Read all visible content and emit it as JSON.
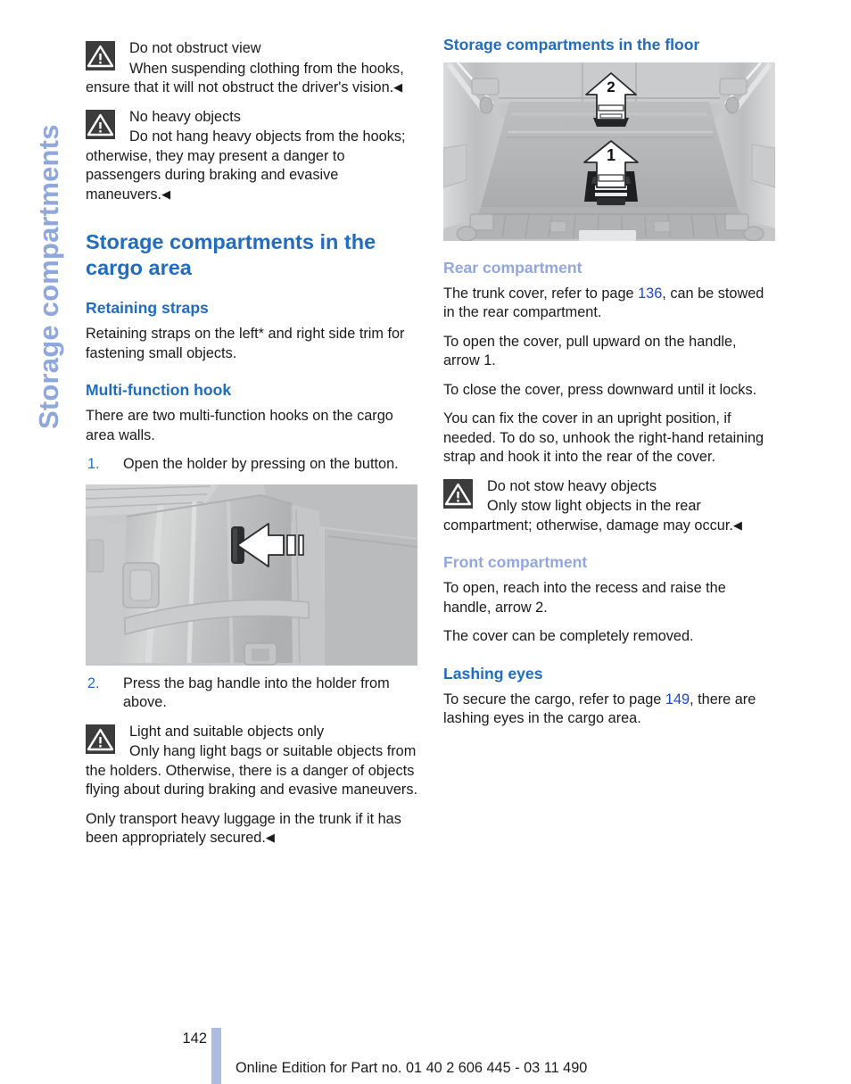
{
  "sidebar": {
    "tab_label": "Storage compartments"
  },
  "left_column": {
    "warning_1": {
      "icon": "warning-triangle-icon",
      "title": "Do not obstruct view",
      "body": "When suspending clothing from the hooks, ensure that it will not obstruct the driver's vision.",
      "end_mark": "◀"
    },
    "warning_2": {
      "icon": "warning-triangle-icon",
      "title": "No heavy objects",
      "body": "Do not hang heavy objects from the hooks; otherwise, they may present a danger to passengers during braking and evasive maneuvers.",
      "end_mark": "◀"
    },
    "heading_main": "Storage compartments in the cargo area",
    "section_retaining_straps": {
      "heading": "Retaining straps",
      "body": "Retaining straps on the left* and right side trim for fastening small objects."
    },
    "section_multifunction_hook": {
      "heading": "Multi-function hook",
      "body": "There are two multi-function hooks on the cargo area walls.",
      "steps": [
        {
          "num": "1.",
          "text": "Open the holder by pressing on the button."
        },
        {
          "num": "2.",
          "text": "Press the bag handle into the holder from above."
        }
      ]
    },
    "figure_hook": {
      "caption": "cargo-area-side-trim-with-multi-function-hook",
      "arrow_label": ""
    },
    "warning_3": {
      "icon": "warning-triangle-icon",
      "title": "Light and suitable objects only",
      "body": "Only hang light bags or suitable objects from the holders. Otherwise, there is a danger of objects flying about during braking and evasive maneuvers.",
      "body2": "Only transport heavy luggage in the trunk if it has been appropriately secured.",
      "end_mark": "◀"
    }
  },
  "right_column": {
    "heading_main": "Storage compartments in the floor",
    "figure_floor": {
      "caption": "cargo-floor-storage-compartments",
      "arrow_1": "1",
      "arrow_2": "2"
    },
    "section_rear": {
      "heading": "Rear compartment",
      "para_1_before": "The trunk cover, refer to page ",
      "para_1_ref": "136",
      "para_1_after": ", can be stowed in the rear compartment.",
      "para_2": "To open the cover, pull upward on the handle, arrow 1.",
      "para_3": "To close the cover, press downward until it locks.",
      "para_4": "You can fix the cover in an upright position, if needed. To do so, unhook the right-hand retaining strap and hook it into the rear of the cover."
    },
    "warning_1": {
      "icon": "warning-triangle-icon",
      "title": "Do not stow heavy objects",
      "body": "Only stow light objects in the rear compartment; otherwise, damage may occur.",
      "end_mark": "◀"
    },
    "section_front": {
      "heading": "Front compartment",
      "para_1": "To open, reach into the recess and raise the handle, arrow 2.",
      "para_2": "The cover can be completely removed."
    },
    "section_lashing": {
      "heading": "Lashing eyes",
      "para_1_before": "To secure the cargo, refer to page ",
      "para_1_ref": "149",
      "para_1_after": ", there are lashing eyes in the cargo area."
    }
  },
  "footer": {
    "page_number": "142",
    "edition_text": "Online Edition for Part no. 01 40 2 606 445 - 03 11 490"
  },
  "colors": {
    "heading_blue": "#1f6cc0",
    "pale_blue": "#92a7dd",
    "link_blue": "#1a46d4",
    "warn_icon_bg": "#3c3c3c",
    "footer_bar": "#adbbe2"
  }
}
